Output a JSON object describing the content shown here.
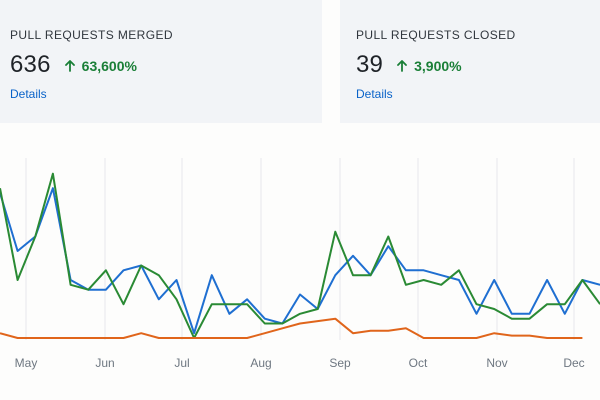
{
  "cards": {
    "merged": {
      "label": "PULL REQUESTS MERGED",
      "value": "636",
      "change": "63,600%",
      "change_direction": "up",
      "change_icon": "arrow-up-icon",
      "link": "Details"
    },
    "closed": {
      "label": "PULL REQUESTS CLOSED",
      "value": "39",
      "change": "3,900%",
      "change_direction": "up",
      "change_icon": "arrow-up-icon",
      "link": "Details"
    }
  },
  "colors": {
    "card_bg": "#f2f4f7",
    "positive": "#1a7f37",
    "link": "#0a63c9",
    "series_blue": "#1f6fd1",
    "series_green": "#2a8a34",
    "series_orange": "#e0651b",
    "gridline": "#e6e8eb"
  },
  "chart_data": {
    "type": "line",
    "x_labels": [
      "May",
      "Jun",
      "Jul",
      "Aug",
      "Sep",
      "Oct",
      "Nov",
      "Dec"
    ],
    "grid": "vertical",
    "ylim": [
      0,
      36
    ],
    "series": [
      {
        "color": "#1f6fd1",
        "values": [
          30,
          18,
          21,
          31,
          12,
          10,
          10,
          14,
          15,
          8,
          12,
          1,
          13,
          5,
          8,
          4,
          3,
          9,
          6,
          13,
          17,
          13,
          19,
          14,
          14,
          13,
          12,
          5,
          12,
          5,
          5,
          12,
          5,
          12,
          11
        ]
      },
      {
        "color": "#2a8a34",
        "values": [
          31,
          12,
          21,
          34,
          11,
          10,
          14,
          7,
          15,
          13,
          8,
          0,
          7,
          7,
          7,
          3,
          3,
          5,
          6,
          22,
          13,
          13,
          21,
          11,
          12,
          11,
          14,
          7,
          6,
          4,
          4,
          7,
          7,
          12,
          7
        ]
      },
      {
        "color": "#e0651b",
        "values": [
          1,
          0,
          0,
          0,
          0,
          0,
          0,
          0,
          1,
          0,
          0,
          0,
          0,
          0,
          0,
          1,
          2,
          3,
          3.5,
          4,
          1,
          1.5,
          1.5,
          2,
          0,
          0,
          0,
          0,
          1,
          0.5,
          0.5,
          0,
          0,
          0
        ]
      }
    ]
  }
}
